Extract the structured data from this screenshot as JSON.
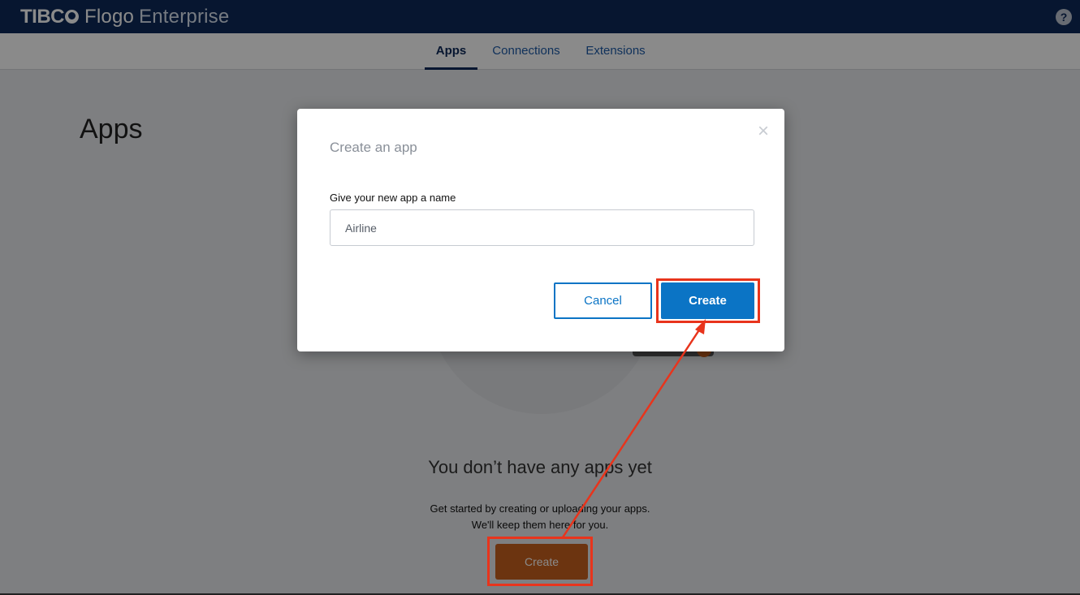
{
  "header": {
    "brand_tibco": "TIBC",
    "brand_flogo": "Flogo",
    "brand_enterprise": "Enterprise",
    "help_label": "?"
  },
  "nav": {
    "tabs": [
      {
        "label": "Apps",
        "active": true
      },
      {
        "label": "Connections",
        "active": false
      },
      {
        "label": "Extensions",
        "active": false
      }
    ]
  },
  "page": {
    "title": "Apps",
    "empty_title": "You don’t have any apps yet",
    "empty_line1": "Get started by creating or uploading your apps.",
    "empty_line2": "We'll keep them here for you.",
    "create_label": "Create"
  },
  "modal": {
    "title": "Create an app",
    "close_label": "×",
    "field_label": "Give your new app a name",
    "input_value": "Airline",
    "cancel_label": "Cancel",
    "create_label": "Create"
  },
  "colors": {
    "header_bg": "#0e2a5a",
    "primary": "#0b74c5",
    "accent_orange": "#c8601e",
    "annotation_red": "#e8341c"
  }
}
